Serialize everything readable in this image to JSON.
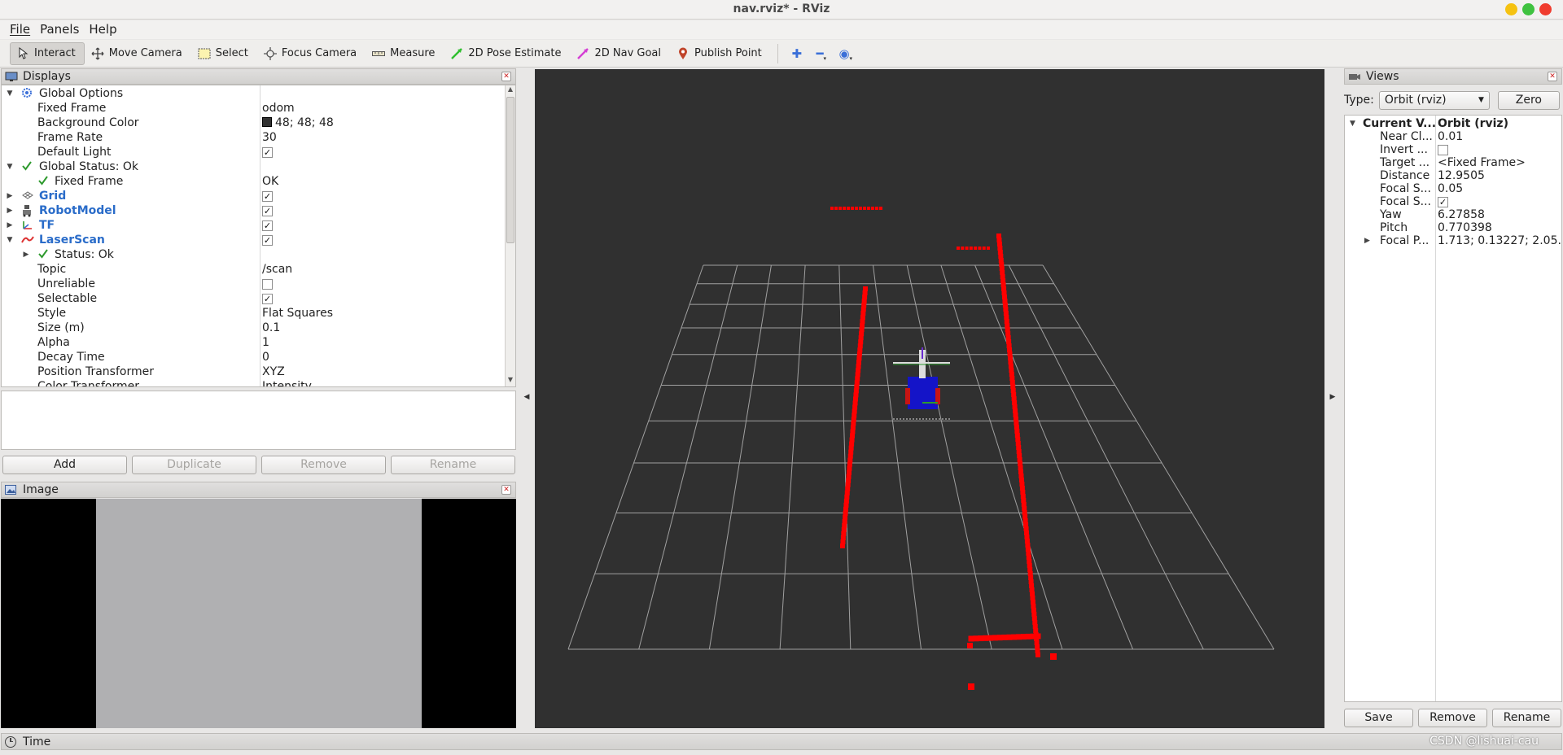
{
  "window": {
    "title": "nav.rviz* - RViz"
  },
  "menu": [
    "File",
    "Panels",
    "Help"
  ],
  "toolbar": {
    "tools": [
      {
        "label": "Interact",
        "icon": "interact-icon",
        "active": true
      },
      {
        "label": "Move Camera",
        "icon": "move-camera-icon",
        "active": false
      },
      {
        "label": "Select",
        "icon": "select-icon",
        "active": false
      },
      {
        "label": "Focus Camera",
        "icon": "focus-camera-icon",
        "active": false
      },
      {
        "label": "Measure",
        "icon": "measure-icon",
        "active": false
      },
      {
        "label": "2D Pose Estimate",
        "icon": "pose-estimate-icon",
        "active": false
      },
      {
        "label": "2D Nav Goal",
        "icon": "nav-goal-icon",
        "active": false
      },
      {
        "label": "Publish Point",
        "icon": "publish-point-icon",
        "active": false
      }
    ],
    "extra_icons": [
      "plus-icon",
      "minus-icon",
      "eye-icon"
    ]
  },
  "displays": {
    "title": "Displays",
    "rows": [
      {
        "label": "Global Options",
        "value": "",
        "indent": 0,
        "expander": "open",
        "icon": "gear-icon"
      },
      {
        "label": "Fixed Frame",
        "value": "odom",
        "indent": 1
      },
      {
        "label": "Background Color",
        "value": "48; 48; 48",
        "indent": 1,
        "swatch": "#303030"
      },
      {
        "label": "Frame Rate",
        "value": "30",
        "indent": 1
      },
      {
        "label": "Default Light",
        "value": "",
        "indent": 1,
        "check": true
      },
      {
        "label": "Global Status: Ok",
        "value": "",
        "indent": 0,
        "expander": "open",
        "icon": "ok-check-icon"
      },
      {
        "label": "Fixed Frame",
        "value": "OK",
        "indent": 1,
        "icon": "ok-check-icon"
      },
      {
        "label": "Grid",
        "value": "",
        "indent": 0,
        "expander": "closed",
        "icon": "grid-icon",
        "blue": true,
        "check": true
      },
      {
        "label": "RobotModel",
        "value": "",
        "indent": 0,
        "expander": "closed",
        "icon": "robot-model-icon",
        "blue": true,
        "check": true
      },
      {
        "label": "TF",
        "value": "",
        "indent": 0,
        "expander": "closed",
        "icon": "tf-icon",
        "blue": true,
        "check": true
      },
      {
        "label": "LaserScan",
        "value": "",
        "indent": 0,
        "expander": "open",
        "icon": "laser-scan-icon",
        "blue": true,
        "check": true
      },
      {
        "label": "Status: Ok",
        "value": "",
        "indent": 1,
        "expander": "closed",
        "icon": "ok-check-icon"
      },
      {
        "label": "Topic",
        "value": "/scan",
        "indent": 1
      },
      {
        "label": "Unreliable",
        "value": "",
        "indent": 1,
        "check": false
      },
      {
        "label": "Selectable",
        "value": "",
        "indent": 1,
        "check": true
      },
      {
        "label": "Style",
        "value": "Flat Squares",
        "indent": 1
      },
      {
        "label": "Size (m)",
        "value": "0.1",
        "indent": 1
      },
      {
        "label": "Alpha",
        "value": "1",
        "indent": 1
      },
      {
        "label": "Decay Time",
        "value": "0",
        "indent": 1
      },
      {
        "label": "Position Transformer",
        "value": "XYZ",
        "indent": 1
      },
      {
        "label": "Color Transformer",
        "value": "Intensity",
        "indent": 1
      }
    ],
    "buttons": [
      {
        "label": "Add",
        "enabled": true
      },
      {
        "label": "Duplicate",
        "enabled": false
      },
      {
        "label": "Remove",
        "enabled": false
      },
      {
        "label": "Rename",
        "enabled": false
      }
    ]
  },
  "image_panel": {
    "title": "Image"
  },
  "views": {
    "title": "Views",
    "type_label": "Type:",
    "type_value": "Orbit (rviz)",
    "zero_label": "Zero",
    "rows": [
      {
        "key": "Current V...",
        "value": "Orbit (rviz)",
        "bold": true,
        "expander": "open"
      },
      {
        "key": "Near Cl...",
        "value": "0.01"
      },
      {
        "key": "Invert ...",
        "value": "",
        "check": false
      },
      {
        "key": "Target ...",
        "value": "<Fixed Frame>"
      },
      {
        "key": "Distance",
        "value": "12.9505"
      },
      {
        "key": "Focal S...",
        "value": "0.05"
      },
      {
        "key": "Focal S...",
        "value": "",
        "check": true
      },
      {
        "key": "Yaw",
        "value": "6.27858"
      },
      {
        "key": "Pitch",
        "value": "0.770398"
      },
      {
        "key": "Focal P...",
        "value": "1.713; 0.13227; 2.05...",
        "expander": "closed"
      }
    ],
    "buttons": [
      "Save",
      "Remove",
      "Rename"
    ]
  },
  "time_panel": {
    "title": "Time"
  },
  "watermark": "CSDN @lishuai-cau",
  "colors": {
    "laser": "#ff0000",
    "grid": "#a0a0a0",
    "viewport_bg": "#303030",
    "link_blue": "#2a6cc9"
  }
}
